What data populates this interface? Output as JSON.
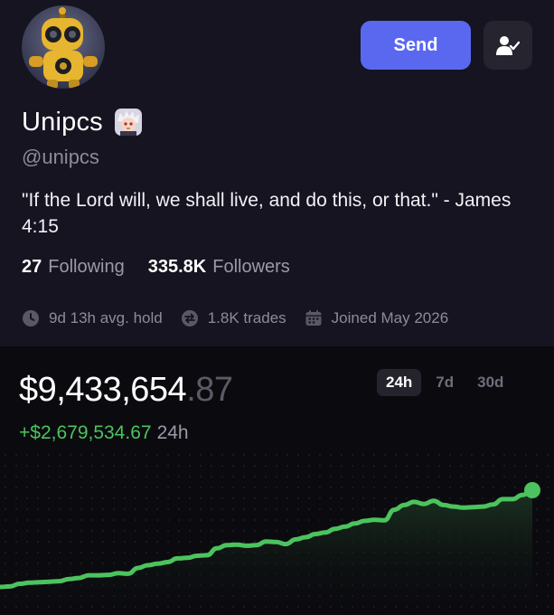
{
  "profile": {
    "name": "Unipcs",
    "handle": "@unipcs",
    "bio": "\"If the Lord will, we shall live, and do this, or that.\" - James 4:15",
    "following_count": "27",
    "following_label": "Following",
    "followers_count": "335.8K",
    "followers_label": "Followers",
    "avatar_icon": "robot-avatar",
    "badge_icon": "anime-character-badge"
  },
  "actions": {
    "send_label": "Send",
    "follow_icon": "user-check-icon"
  },
  "meta": {
    "avg_hold": "9d 13h avg. hold",
    "trades": "1.8K trades",
    "joined": "Joined May 2026"
  },
  "portfolio": {
    "balance_main": "$9,433,654",
    "balance_cents": ".87",
    "change": "+$2,679,534.67",
    "change_period": "24h"
  },
  "ranges": [
    "24h",
    "7d",
    "30d"
  ],
  "selected_range": "24h",
  "colors": {
    "accent": "#5a68f0",
    "positive": "#4cc35e",
    "background": "#161420",
    "chart_background": "#0b0b0f"
  },
  "chart_data": {
    "type": "line",
    "series": [
      {
        "values": [
          1.0,
          1.1,
          1.6,
          1.8,
          1.9,
          2.0,
          2.1,
          2.5,
          2.7,
          3.2,
          3.2,
          3.3,
          3.6,
          3.5,
          4.6,
          5.1,
          5.4,
          5.7,
          6.4,
          6.5,
          6.9,
          7.0,
          8.3,
          8.9,
          9.0,
          8.8,
          8.9,
          9.6,
          9.5,
          9.1,
          10.0,
          10.4,
          11.0,
          11.3,
          12.0,
          12.4,
          13.0,
          13.5,
          13.7,
          13.6,
          15.6,
          16.5,
          17.1,
          16.7,
          17.3,
          16.5,
          16.2,
          16.0,
          16.1,
          16.2,
          16.6,
          17.6,
          17.6,
          18.4,
          19.3
        ]
      }
    ]
  }
}
